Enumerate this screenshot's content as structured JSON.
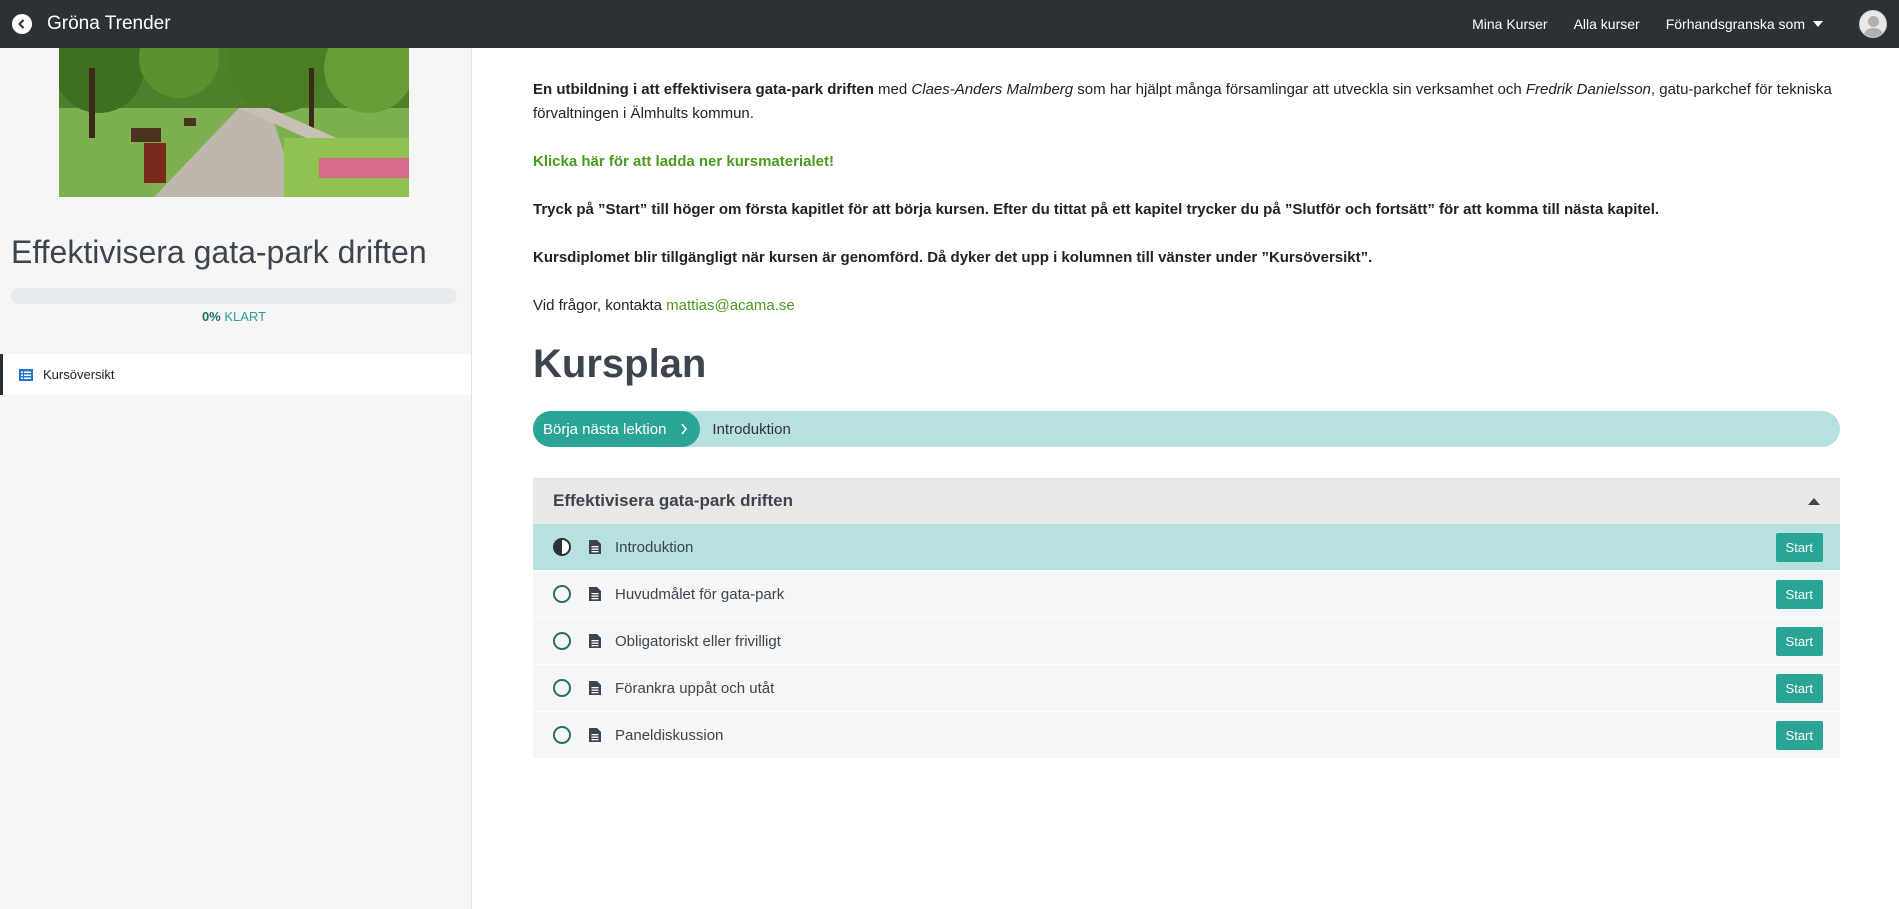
{
  "header": {
    "brand": "Gröna Trender",
    "nav": {
      "my_courses": "Mina Kurser",
      "all_courses": "Alla kurser",
      "preview_as": "Förhandsgranska som"
    }
  },
  "sidebar": {
    "course_title": "Effektivisera gata-park driften",
    "progress_percent": 0,
    "progress_value": "0%",
    "progress_label": " KLART",
    "menu": [
      {
        "label": "Kursöversikt",
        "icon": "list-icon"
      }
    ]
  },
  "main": {
    "intro": {
      "bold": "En utbildning i att effektivisera gata-park driften",
      "t1": " med ",
      "i1": "Claes-Anders Malmberg",
      "t2": " som har hjälpt många församlingar att utveckla sin verksamhet och ",
      "i2": "Fredrik Danielsson",
      "t3": ", gatu-parkchef för tekniska förvaltningen i Älmhults kommun."
    },
    "download_link": "Klicka här för att ladda ner kursmaterialet!",
    "instructions": "Tryck på ”Start” till höger om första kapitlet för att börja kursen. Efter du tittat på ett kapitel trycker du på ”Slutför och fortsätt” för att komma till nästa kapitel.",
    "diploma": "Kursdiplomet blir tillgängligt när kursen är genomförd. Då dyker det upp i kolumnen till vänster under ”Kursöversikt”.",
    "contact_text": "Vid frågor, kontakta ",
    "contact_email": "mattias@acama.se",
    "kursplan_title": "Kursplan",
    "next_button": "Börja nästa lektion",
    "next_lesson": "Introduktion",
    "section": {
      "title": "Effektivisera gata-park driften",
      "lessons": [
        {
          "label": "Introduktion",
          "start": "Start",
          "status": "in-progress"
        },
        {
          "label": "Huvudmålet för gata-park",
          "start": "Start",
          "status": "not-started"
        },
        {
          "label": "Obligatoriskt eller frivilligt",
          "start": "Start",
          "status": "not-started"
        },
        {
          "label": "Förankra uppåt och utåt",
          "start": "Start",
          "status": "not-started"
        },
        {
          "label": "Paneldiskussion",
          "start": "Start",
          "status": "not-started"
        }
      ]
    }
  },
  "colors": {
    "topbar": "#2b3135",
    "accent": "#2aa595",
    "accent_light": "#b7e1de",
    "link_green": "#4a9a1d"
  }
}
